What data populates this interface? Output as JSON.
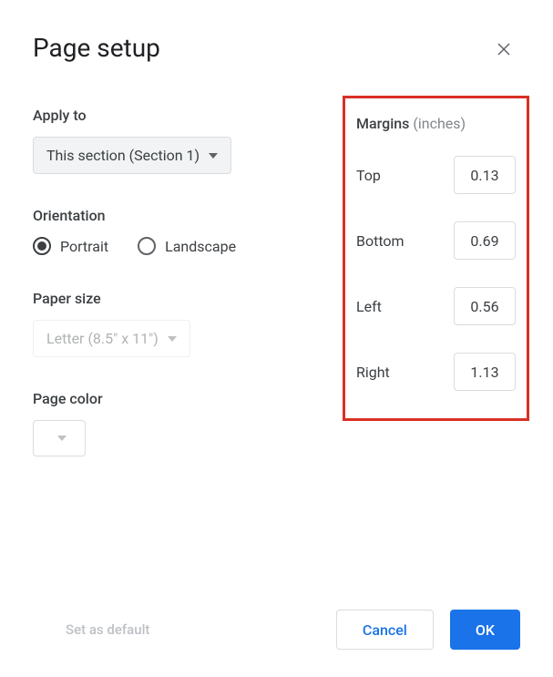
{
  "dialog": {
    "title": "Page setup"
  },
  "applyTo": {
    "label": "Apply to",
    "selected": "This section (Section 1)"
  },
  "orientation": {
    "label": "Orientation",
    "portrait": "Portrait",
    "landscape": "Landscape"
  },
  "paperSize": {
    "label": "Paper size",
    "selected": "Letter (8.5\" x 11\")"
  },
  "pageColor": {
    "label": "Page color"
  },
  "margins": {
    "label": "Margins",
    "unit": "(inches)",
    "top": {
      "name": "Top",
      "value": "0.13"
    },
    "bottom": {
      "name": "Bottom",
      "value": "0.69"
    },
    "left": {
      "name": "Left",
      "value": "0.56"
    },
    "right": {
      "name": "Right",
      "value": "1.13"
    }
  },
  "footer": {
    "setDefault": "Set as default",
    "cancel": "Cancel",
    "ok": "OK"
  }
}
